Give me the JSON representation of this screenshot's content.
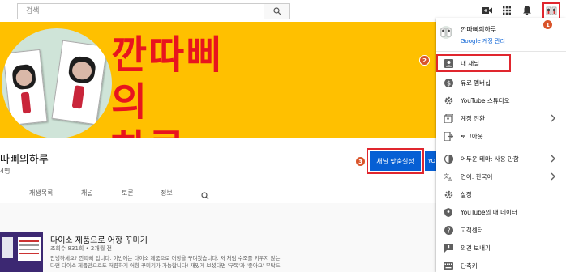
{
  "search": {
    "placeholder": "검색"
  },
  "banner": {
    "line1": "깐따삐의",
    "line2": "하루"
  },
  "channel": {
    "name": "따삐의하루",
    "subscribers": "4명",
    "customize_label": "채널 맞춤설정",
    "studio_peek": "YO"
  },
  "tabs": [
    "",
    "재생목록",
    "채널",
    "토론",
    "정보"
  ],
  "video": {
    "title": "다이소 제품으로 어항 꾸미기",
    "meta": "조회수 831회 • 2개월 전",
    "desc_line1": "안녕하세요? 깐따삐 입니다. 이번에는 다이소 제품으로 어항을 꾸며봤습니다. 저 처럼 수조를 키우지 않는",
    "desc_line2": "다면 다이소 제품만으로도 저렴하게 어항 꾸미기가 가능합니다! 재밌게 보셨다면 '구독'과 '좋아요' 부탁드"
  },
  "menu": {
    "user_name": "깐따삐의하루",
    "manage_account": "Google 계정 관리",
    "items": [
      {
        "label": "내 채널",
        "icon": "person-box-icon"
      },
      {
        "label": "유료 멤버십",
        "icon": "dollar-icon"
      },
      {
        "label": "YouTube 스튜디오",
        "icon": "gear-icon"
      },
      {
        "label": "계정 전환",
        "icon": "switch-account-icon"
      },
      {
        "label": "로그아웃",
        "icon": "logout-icon"
      },
      {
        "label": "어두운 테마: 사용 안함",
        "icon": "theme-icon"
      },
      {
        "label": "언어: 한국어",
        "icon": "translate-icon"
      },
      {
        "label": "설정",
        "icon": "settings-icon"
      },
      {
        "label": "YouTube의 내 데이터",
        "icon": "shield-icon"
      },
      {
        "label": "고객센터",
        "icon": "help-icon"
      },
      {
        "label": "의견 보내기",
        "icon": "feedback-icon"
      },
      {
        "label": "단축키",
        "icon": "keyboard-icon"
      }
    ]
  },
  "callouts": [
    "1",
    "2",
    "3"
  ],
  "colors": {
    "banner": "#ffc000",
    "banner_text": "#e8141e",
    "accent_blue": "#065fd4",
    "callout": "#d9542a"
  }
}
